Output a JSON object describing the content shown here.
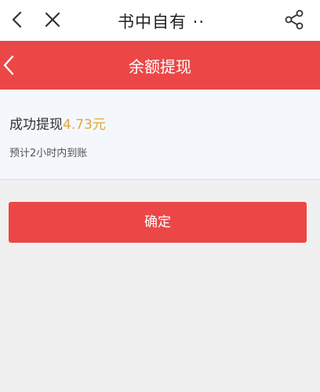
{
  "topbar": {
    "title": "书中自有 ··",
    "back_icon": "chevron-left-icon",
    "close_icon": "close-icon",
    "share_icon": "share-icon"
  },
  "header": {
    "title": "余额提现",
    "back_icon": "chevron-left-icon",
    "bg_color": "#eb4747"
  },
  "result": {
    "label": "成功提现",
    "amount": "4.73元",
    "amount_color": "#e2a83c",
    "note": "预计2小时内到账"
  },
  "actions": {
    "confirm_label": "确定"
  }
}
